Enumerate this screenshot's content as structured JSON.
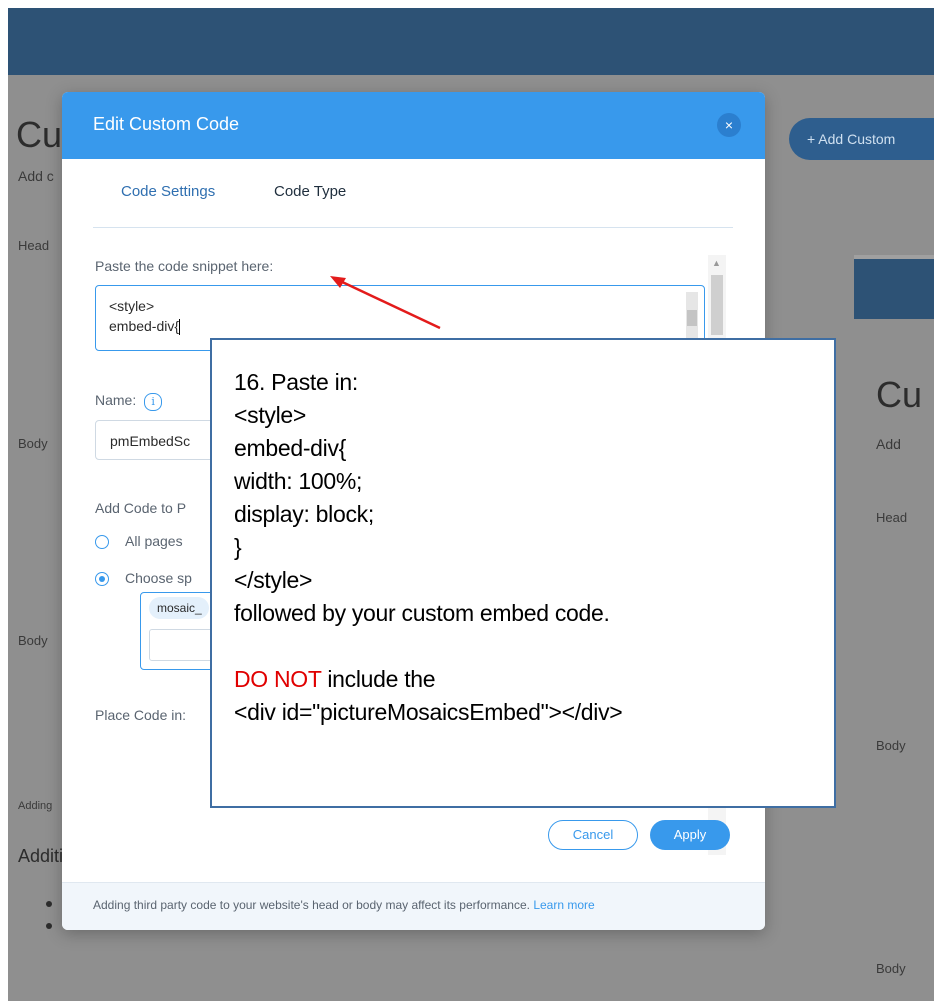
{
  "background": {
    "page_title": "Cu",
    "page_subtitle": "Add c",
    "head_label": "Head",
    "body_label": "Body",
    "body_label_2": "Body",
    "adding_label": "Adding",
    "additional_label": "Additi",
    "add_custom_button": "+  Add Custom",
    "panel_title": "Cu",
    "panel_add": "Add",
    "panel_head": "Head",
    "panel_body": "Body",
    "panel_body_2": "Body"
  },
  "modal": {
    "title": "Edit Custom Code",
    "close_glyph": "×",
    "tabs": [
      {
        "label": "Code Settings",
        "active": true
      },
      {
        "label": "Code Type",
        "active": false
      }
    ],
    "paste_label": "Paste the code snippet here:",
    "code_lines": [
      "<style>",
      "embed-div{"
    ],
    "name_label": "Name:",
    "info_glyph": "i",
    "name_value": "pmEmbedSc",
    "add_code_label": "Add Code to P",
    "radio_all_pages": "All pages",
    "radio_choose": "Choose sp",
    "chosen_page_chip": "mosaic_",
    "place_code_label": "Place Code in:",
    "cancel_button": "Cancel",
    "apply_button": "Apply",
    "footer_text": "Adding third party code to your website's head or body may affect its performance.",
    "footer_link": "Learn more"
  },
  "callout": {
    "lines": [
      "16. Paste in:",
      "<style>",
      "embed-div{",
      "width: 100%;",
      "display: block;",
      "}",
      "</style>",
      "followed by your custom embed code.",
      ""
    ],
    "warning_red": "DO NOT",
    "warning_rest": " include the",
    "final_line": "<div id=\"pictureMosaicsEmbed\"></div>"
  },
  "colors": {
    "accent": "#3899ec",
    "topbar": "#2d5275",
    "overlay": "#8f8f8f",
    "callout_border": "#3f6ea3",
    "warning": "#e00000"
  }
}
